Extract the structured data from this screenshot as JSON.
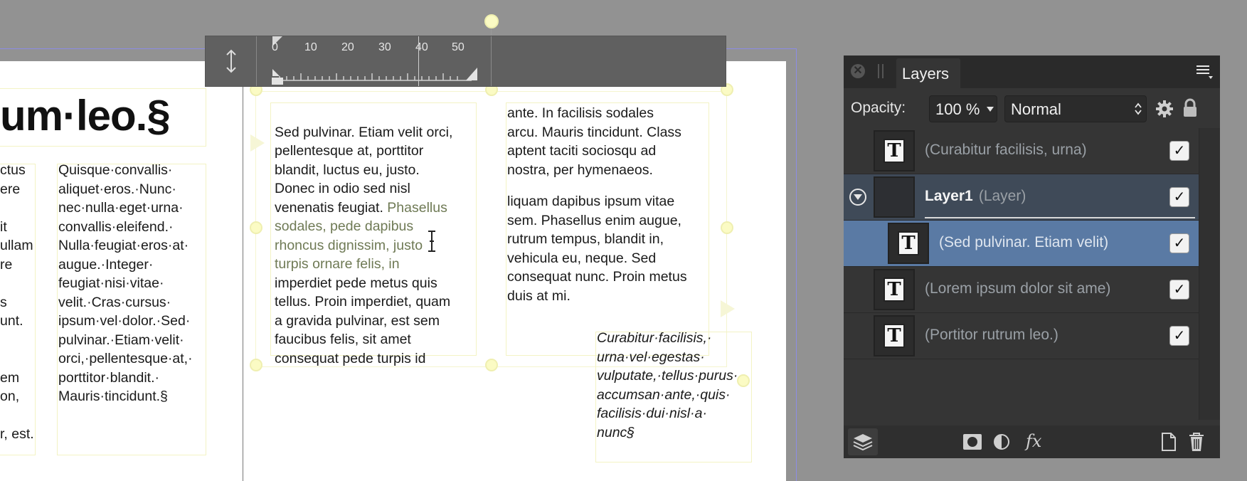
{
  "document": {
    "heading": "um·leo.§",
    "col_a_lines": "ctus\nere\n\nit\nullam\nre\n\ns\nunt.\n\n\nem\non,\n\nr, est.",
    "col_b": "Quisque·convallis·\naliquet·eros.·Nunc·\nnec·nulla·eget·urna·\nconvallis·eleifend.·\nNulla·feugiat·eros·at·\naugue.·Integer·\nfeugiat·nisi·vitae·\nvelit.·Cras·cursus·\nipsum·vel·dolor.·Sed·\npulvinar.·Etiam·velit·\norci,·pellentesque·at,·\nporttitor·blandit.·\nMauris·tincidunt.§",
    "col_c_pre": "Sed pulvinar. Etiam velit orci,\npellentesque at, porttitor\nblandit, luctus eu, justo.\nDonec in odio sed nisl\nvenenatis feugiat. ",
    "col_c_highlight": "Phasellus\nsodales, pede dapibus\nrhoncus dignissim, justo\nturpis ornare felis, in",
    "col_c_post": "\nimperdiet pede metus quis\ntellus. Proin imperdiet, quam\na gravida pulvinar, est sem\nfaucibus felis, sit amet\nconsequat pede turpis id",
    "col_d_p1": "ante. In facilisis sodales\narcu. Mauris tincidunt. Class\naptent taciti sociosqu ad\nnostra, per hymenaeos.",
    "col_d_p2": "liquam dapibus ipsum vitae\nsem. Phasellus enim augue,\nrutrum tempus, blandit in,\nvehicula eu, neque. Sed\nconsequat nunc. Proin metus\nduis at mi.",
    "italic": "Curabitur·facilisis,·\nurna·vel·egestas·\nvulputate,·tellus·purus·\naccumsan·ante,·quis·\nfacilisis·dui·nisl·a·\nnunc§"
  },
  "ruler": {
    "ticks": [
      "0",
      "10",
      "20",
      "30",
      "40",
      "50"
    ]
  },
  "layers_panel": {
    "tab_label": "Layers",
    "opacity_label": "Opacity:",
    "opacity_value": "100 %",
    "blend_mode": "Normal",
    "layers": [
      {
        "name": "(Curabitur facilisis, urna)"
      },
      {
        "name_bold": "Layer1",
        "name_suffix": " (Layer)"
      },
      {
        "name": "(Sed pulvinar. Etiam velit)"
      },
      {
        "name": "(Lorem ipsum dolor sit ame)"
      },
      {
        "name": "(Portitor rutrum leo.)"
      }
    ],
    "fx_label": "fx",
    "colors": {
      "panel": "#353535",
      "selected_row": "#5a7aa4",
      "group_row": "#3f4a58"
    }
  }
}
